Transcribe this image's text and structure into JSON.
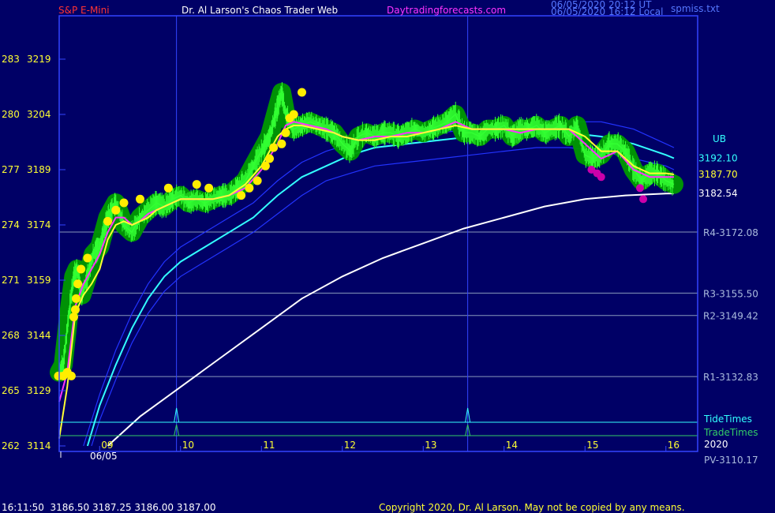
{
  "header": {
    "instrument": "S&P E-Mini",
    "site": "Dr. Al Larson's Chaos Trader Web",
    "url": "Daytradingforecasts.com",
    "timestamp_utc": "06/05/2020 20:12 UT",
    "timestamp_local": "06/05/2020 16:12 Local",
    "file": "spmiss.txt"
  },
  "footer": {
    "quote": "16:11:50  3186.50 3187.25 3186.00 3187.00",
    "copyright": "Copyright 2020, Dr. Al Larson. May not be copied by any means."
  },
  "colors": {
    "background": "#000066",
    "frame": "#3344ff",
    "price": "#33ff33",
    "price_halo": "#009900",
    "sma_fast": "#ff33ff",
    "ema_yellow": "#ffff33",
    "band_blue": "#2233ff",
    "band_cyan": "#33ffff",
    "vwap_white": "#ffffff",
    "level_line": "#8899bb",
    "tide_line": "#33ffff",
    "trade_line": "#33cc66",
    "markers_yellow": "#ffee00",
    "markers_magenta": "#cc00aa"
  },
  "chart_data": {
    "type": "line",
    "title": "S&P E-Mini",
    "date": "06/05",
    "year": "2020",
    "ylim": [
      3114,
      3229
    ],
    "xlim": [
      8.5,
      16.25
    ],
    "y_ticks": [
      {
        "price": 3219,
        "astro": 283
      },
      {
        "price": 3204,
        "astro": 280
      },
      {
        "price": 3189,
        "astro": 277
      },
      {
        "price": 3174,
        "astro": 274
      },
      {
        "price": 3159,
        "astro": 271
      },
      {
        "price": 3144,
        "astro": 268
      },
      {
        "price": 3129,
        "astro": 265
      },
      {
        "price": 3114,
        "astro": 262
      }
    ],
    "x_ticks": [
      {
        "hour": 9,
        "label": "09"
      },
      {
        "hour": 10,
        "label": "10"
      },
      {
        "hour": 11,
        "label": "11"
      },
      {
        "hour": 12,
        "label": "12"
      },
      {
        "hour": 13,
        "label": "13"
      },
      {
        "hour": 14,
        "label": "14"
      },
      {
        "hour": 15,
        "label": "15"
      },
      {
        "hour": 16,
        "label": "16"
      }
    ],
    "vertical_markers": [
      9.95,
      13.55
    ],
    "levels": [
      {
        "label": "R4-3172.08",
        "value": 3172.08
      },
      {
        "label": "R3-3155.50",
        "value": 3155.5
      },
      {
        "label": "R2-3149.42",
        "value": 3149.42
      },
      {
        "label": "R1-3132.83",
        "value": 3132.83
      }
    ],
    "pv_label": "PV-3110.17",
    "ub_label": "UB",
    "end_values": [
      {
        "label": "3192.10",
        "value": 3192.1
      },
      {
        "label": "3187.70",
        "value": 3187.7
      },
      {
        "label": "3182.54",
        "value": 3182.54
      }
    ],
    "tide_label": "TideTimes",
    "trade_label": "TradeTimes",
    "tide_spikes": [
      9.95,
      13.55
    ],
    "trade_spikes": [
      9.95,
      13.55
    ],
    "series": [
      {
        "name": "Price",
        "x": [
          8.5,
          8.55,
          8.62,
          8.68,
          8.72,
          8.78,
          8.85,
          8.92,
          9.0,
          9.05,
          9.1,
          9.15,
          9.2,
          9.3,
          9.4,
          9.5,
          9.6,
          9.7,
          9.8,
          9.9,
          10.0,
          10.1,
          10.2,
          10.3,
          10.4,
          10.5,
          10.6,
          10.7,
          10.8,
          10.9,
          11.0,
          11.05,
          11.1,
          11.15,
          11.2,
          11.25,
          11.3,
          11.35,
          11.4,
          11.5,
          11.6,
          11.7,
          11.8,
          11.9,
          12.0,
          12.1,
          12.2,
          12.3,
          12.4,
          12.5,
          12.6,
          12.7,
          12.8,
          12.9,
          13.0,
          13.1,
          13.2,
          13.3,
          13.4,
          13.5,
          13.6,
          13.7,
          13.8,
          13.9,
          14.0,
          14.1,
          14.2,
          14.3,
          14.4,
          14.5,
          14.6,
          14.7,
          14.8,
          14.9,
          15.0,
          15.1,
          15.2,
          15.3,
          15.4,
          15.5,
          15.6,
          15.7,
          15.8,
          15.9,
          16.0,
          16.1
        ],
        "values": [
          3134,
          3136,
          3150,
          3160,
          3162,
          3155,
          3160,
          3166,
          3168,
          3172,
          3176,
          3178,
          3180,
          3174,
          3172,
          3176,
          3178,
          3180,
          3179,
          3181,
          3182,
          3180,
          3181,
          3180,
          3181,
          3182,
          3182,
          3184,
          3186,
          3190,
          3194,
          3196,
          3198,
          3202,
          3206,
          3210,
          3204,
          3202,
          3200,
          3201,
          3202,
          3201,
          3200,
          3199,
          3196,
          3194,
          3198,
          3199,
          3198,
          3199,
          3199,
          3198,
          3199,
          3200,
          3199,
          3200,
          3201,
          3202,
          3204,
          3199,
          3199,
          3198,
          3200,
          3200,
          3201,
          3198,
          3200,
          3200,
          3201,
          3199,
          3200,
          3201,
          3198,
          3201,
          3193,
          3192,
          3193,
          3196,
          3196,
          3194,
          3189,
          3186,
          3188,
          3188,
          3186,
          3185
        ]
      },
      {
        "name": "Yellow MA",
        "x": [
          8.5,
          8.6,
          8.7,
          8.8,
          8.9,
          9.0,
          9.1,
          9.2,
          9.3,
          9.4,
          9.5,
          9.6,
          9.7,
          9.8,
          9.9,
          10.0,
          10.2,
          10.4,
          10.6,
          10.8,
          11.0,
          11.1,
          11.2,
          11.3,
          11.4,
          11.5,
          11.7,
          11.9,
          12.0,
          12.2,
          12.4,
          12.6,
          12.8,
          13.0,
          13.2,
          13.4,
          13.6,
          13.8,
          14.0,
          14.2,
          14.4,
          14.6,
          14.8,
          15.0,
          15.2,
          15.4,
          15.6,
          15.8,
          16.0,
          16.1
        ],
        "values": [
          3116,
          3130,
          3150,
          3155,
          3158,
          3162,
          3170,
          3174,
          3175,
          3174,
          3175,
          3176,
          3178,
          3179,
          3180,
          3181,
          3181,
          3181,
          3182,
          3185,
          3190,
          3194,
          3198,
          3200,
          3201,
          3201,
          3200,
          3199,
          3198,
          3197,
          3197,
          3198,
          3198,
          3199,
          3200,
          3201,
          3200,
          3200,
          3200,
          3200,
          3200,
          3200,
          3200,
          3198,
          3194,
          3194,
          3190,
          3188,
          3188,
          3187.7
        ]
      },
      {
        "name": "Magenta MA",
        "x": [
          8.5,
          8.6,
          8.7,
          8.8,
          8.9,
          9.0,
          9.1,
          9.2,
          9.3,
          9.4,
          9.5,
          9.6,
          9.7,
          9.8,
          10.0,
          10.2,
          10.4,
          10.6,
          10.8,
          11.0,
          11.2,
          11.3,
          11.4,
          11.6,
          11.8,
          12.0,
          12.2,
          12.4,
          12.6,
          12.8,
          13.0,
          13.2,
          13.4,
          13.6,
          13.8,
          14.0,
          14.2,
          14.4,
          14.6,
          14.8,
          15.0,
          15.2,
          15.4,
          15.6,
          15.8,
          16.0,
          16.1
        ],
        "values": [
          3126,
          3134,
          3152,
          3158,
          3162,
          3166,
          3172,
          3176,
          3176,
          3174,
          3175,
          3177,
          3178,
          3179,
          3181,
          3181,
          3181,
          3182,
          3184,
          3189,
          3196,
          3201,
          3202,
          3201,
          3200,
          3198,
          3197,
          3198,
          3198,
          3199,
          3199,
          3200,
          3202,
          3200,
          3200,
          3200,
          3199,
          3200,
          3200,
          3200,
          3196,
          3192,
          3194,
          3189,
          3187,
          3187,
          3187
        ]
      },
      {
        "name": "Upper Blue Band",
        "x": [
          8.8,
          9.0,
          9.2,
          9.4,
          9.6,
          9.8,
          10.0,
          10.3,
          10.6,
          10.9,
          11.2,
          11.5,
          11.8,
          12.1,
          12.4,
          12.8,
          13.2,
          13.6,
          14.0,
          14.4,
          14.8,
          15.2,
          15.6,
          16.0,
          16.1
        ],
        "values": [
          3114,
          3128,
          3140,
          3150,
          3158,
          3164,
          3168,
          3172,
          3176,
          3180,
          3186,
          3191,
          3194,
          3196,
          3197,
          3198,
          3199,
          3200,
          3201,
          3202,
          3202,
          3202,
          3200,
          3196,
          3195
        ]
      },
      {
        "name": "Cyan Band",
        "x": [
          8.85,
          9.0,
          9.2,
          9.4,
          9.6,
          9.8,
          10.0,
          10.3,
          10.6,
          10.9,
          11.2,
          11.5,
          11.8,
          12.1,
          12.4,
          12.8,
          13.2,
          13.6,
          14.0,
          14.4,
          14.8,
          15.2,
          15.6,
          16.0,
          16.1
        ],
        "values": [
          3114,
          3125,
          3136,
          3146,
          3154,
          3160,
          3164,
          3168,
          3172,
          3176,
          3182,
          3187,
          3190,
          3193,
          3195,
          3196,
          3197,
          3198,
          3199,
          3199,
          3199,
          3198,
          3196,
          3193,
          3192.1
        ]
      },
      {
        "name": "Lower Blue Band",
        "x": [
          8.9,
          9.0,
          9.2,
          9.4,
          9.6,
          9.8,
          10.0,
          10.3,
          10.6,
          10.9,
          11.2,
          11.5,
          11.8,
          12.1,
          12.4,
          12.8,
          13.2,
          13.6,
          14.0,
          14.4,
          14.8,
          15.2,
          15.6,
          16.0,
          16.1
        ],
        "values": [
          3114,
          3121,
          3132,
          3142,
          3150,
          3156,
          3160,
          3164,
          3168,
          3172,
          3177,
          3182,
          3186,
          3188,
          3190,
          3191,
          3192,
          3193,
          3194,
          3195,
          3195,
          3194,
          3192,
          3190,
          3189
        ]
      },
      {
        "name": "White Line",
        "x": [
          9.1,
          9.5,
          10.0,
          10.5,
          11.0,
          11.5,
          12.0,
          12.5,
          13.0,
          13.5,
          14.0,
          14.5,
          15.0,
          15.5,
          16.0,
          16.1
        ],
        "values": [
          3114,
          3122,
          3130,
          3138,
          3146,
          3154,
          3160,
          3165,
          3169,
          3173,
          3176,
          3179,
          3181,
          3182,
          3182.5,
          3182.54
        ]
      }
    ],
    "yellow_markers": [
      {
        "x": 8.49,
        "y": 3133
      },
      {
        "x": 8.55,
        "y": 3133
      },
      {
        "x": 8.6,
        "y": 3134
      },
      {
        "x": 8.65,
        "y": 3133
      },
      {
        "x": 8.68,
        "y": 3149
      },
      {
        "x": 8.7,
        "y": 3151
      },
      {
        "x": 8.71,
        "y": 3154
      },
      {
        "x": 8.73,
        "y": 3158
      },
      {
        "x": 8.77,
        "y": 3162
      },
      {
        "x": 8.85,
        "y": 3165
      },
      {
        "x": 9.1,
        "y": 3175
      },
      {
        "x": 9.2,
        "y": 3178
      },
      {
        "x": 9.3,
        "y": 3180
      },
      {
        "x": 9.5,
        "y": 3181
      },
      {
        "x": 9.85,
        "y": 3184
      },
      {
        "x": 10.2,
        "y": 3185
      },
      {
        "x": 10.35,
        "y": 3184
      },
      {
        "x": 10.75,
        "y": 3182
      },
      {
        "x": 10.85,
        "y": 3184
      },
      {
        "x": 10.95,
        "y": 3186
      },
      {
        "x": 11.05,
        "y": 3190
      },
      {
        "x": 11.1,
        "y": 3192
      },
      {
        "x": 11.15,
        "y": 3195
      },
      {
        "x": 11.25,
        "y": 3196
      },
      {
        "x": 11.3,
        "y": 3199
      },
      {
        "x": 11.35,
        "y": 3203
      },
      {
        "x": 11.4,
        "y": 3204
      },
      {
        "x": 11.5,
        "y": 3210
      }
    ],
    "magenta_markers": [
      {
        "x": 15.08,
        "y": 3189
      },
      {
        "x": 15.15,
        "y": 3188
      },
      {
        "x": 15.2,
        "y": 3187
      },
      {
        "x": 15.68,
        "y": 3184
      },
      {
        "x": 15.72,
        "y": 3181
      }
    ]
  }
}
